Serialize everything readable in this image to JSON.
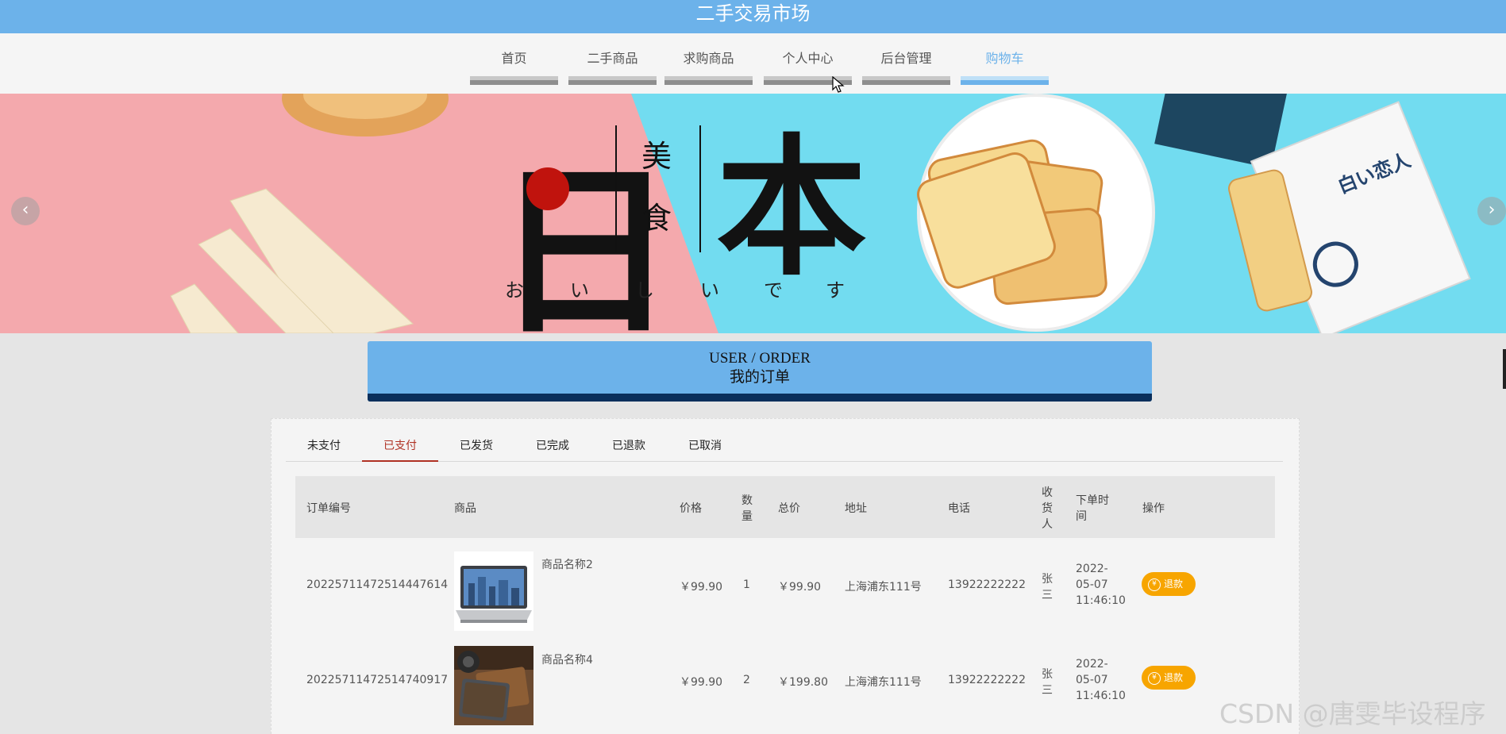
{
  "site": {
    "title": "二手交易市场"
  },
  "nav": {
    "items": [
      {
        "label": "首页",
        "active": false
      },
      {
        "label": "二手商品",
        "active": false
      },
      {
        "label": "求购商品",
        "active": false
      },
      {
        "label": "个人中心",
        "active": false
      },
      {
        "label": "后台管理",
        "active": false
      },
      {
        "label": "购物车",
        "active": true
      }
    ]
  },
  "banner": {
    "big_char_left": "日",
    "big_char_right": "本",
    "small_chars": [
      "美",
      "食"
    ],
    "kana": [
      "お",
      "い",
      "し",
      "い",
      "で",
      "す"
    ],
    "package_text": "白い恋人",
    "prev_arrow": "‹",
    "next_arrow": "›",
    "colors": {
      "pink": "#f4a9ad",
      "cyan": "#72dcf0",
      "sun": "#c0130d"
    }
  },
  "section": {
    "title_en": "USER / ORDER",
    "title_cn": "我的订单"
  },
  "tabs": [
    {
      "label": "未支付",
      "active": false
    },
    {
      "label": "已支付",
      "active": true
    },
    {
      "label": "已发货",
      "active": false
    },
    {
      "label": "已完成",
      "active": false
    },
    {
      "label": "已退款",
      "active": false
    },
    {
      "label": "已取消",
      "active": false
    }
  ],
  "table": {
    "headers": {
      "order_no": "订单编号",
      "product": "商品",
      "price": "价格",
      "qty_1": "数",
      "qty_2": "量",
      "total": "总价",
      "address": "地址",
      "phone": "电话",
      "receiver_1": "收",
      "receiver_2": "货",
      "receiver_3": "人",
      "time_1": "下单时",
      "time_2": "间",
      "action": "操作"
    },
    "rows": [
      {
        "order_no": "20225711472514447614",
        "product_name": "商品名称2",
        "product_image": "laptop",
        "price": "￥99.90",
        "qty": "1",
        "total": "￥99.90",
        "address": "上海浦东111号",
        "phone": "13922222222",
        "receiver_1": "张",
        "receiver_2": "三",
        "time_1": "2022-",
        "time_2": "05-07",
        "time_3": "11:46:10",
        "action_label": "退款"
      },
      {
        "order_no": "20225711472514740917",
        "product_name": "商品名称4",
        "product_image": "wallet",
        "price": "￥99.90",
        "qty": "2",
        "total": "￥199.80",
        "address": "上海浦东111号",
        "phone": "13922222222",
        "receiver_1": "张",
        "receiver_2": "三",
        "time_1": "2022-",
        "time_2": "05-07",
        "time_3": "11:46:10",
        "action_label": "退款"
      }
    ]
  },
  "watermark": "CSDN @唐雯毕设程序"
}
